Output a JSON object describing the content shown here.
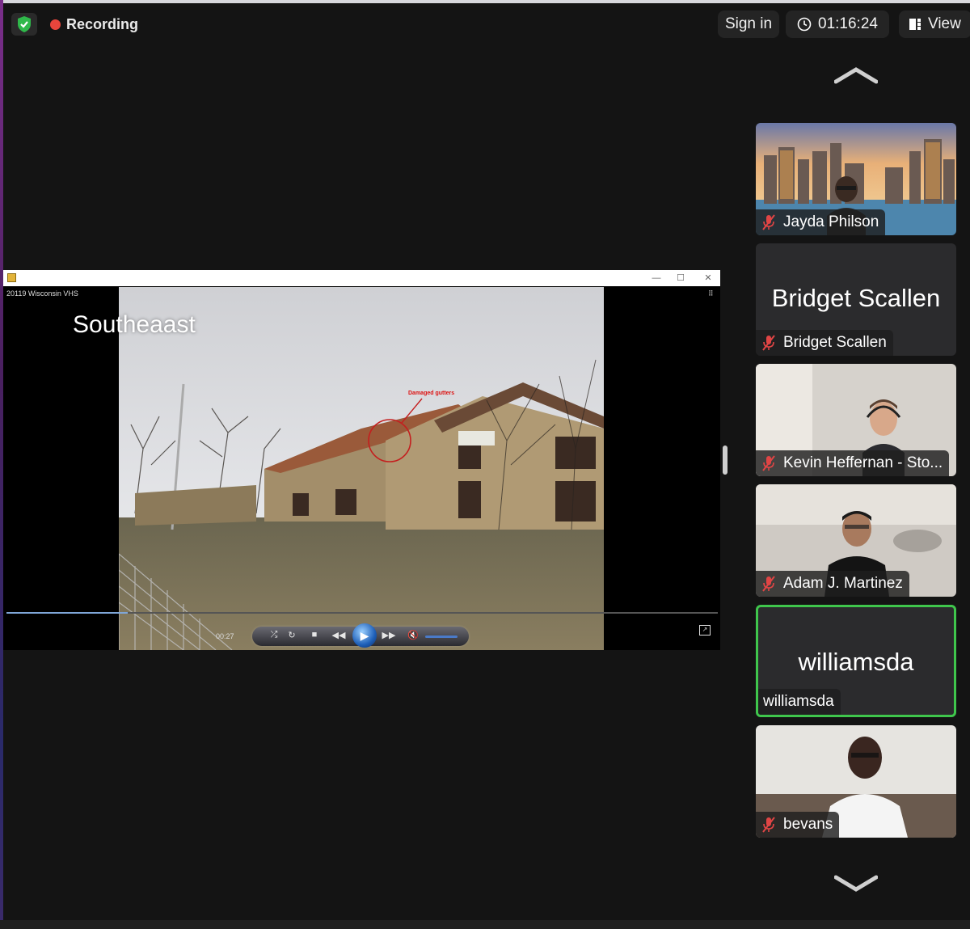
{
  "top": {
    "recording_label": "Recording",
    "signin_label": "Sign in",
    "timer": "01:16:24",
    "view_label": "View"
  },
  "share": {
    "window_label": "20119 Wisconsin VHS",
    "slide_title": "Southeaast",
    "annotation": "Damaged gutters",
    "timecode": "00:27",
    "progress": 0.17
  },
  "participants": [
    {
      "name": "Jayda Philson",
      "muted": true,
      "video": true
    },
    {
      "name": "Bridget Scallen",
      "display": "Bridget Scallen",
      "muted": true,
      "video": false
    },
    {
      "name": "Kevin Heffernan - Sto...",
      "muted": true,
      "video": true
    },
    {
      "name": "Adam J. Martinez",
      "muted": true,
      "video": true
    },
    {
      "name": "williamsda",
      "display": "williamsda",
      "muted": false,
      "video": false,
      "active": true
    },
    {
      "name": "bevans",
      "muted": true,
      "video": true
    }
  ],
  "colors": {
    "active_speaker": "#3fc64c",
    "recording_dot": "#e8453c",
    "muted_icon": "#e04545"
  }
}
